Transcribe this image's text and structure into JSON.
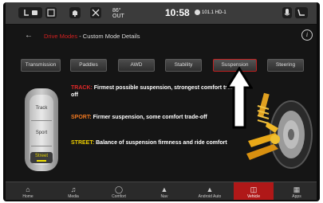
{
  "statusbar": {
    "outside_temp_label": "86°",
    "outside_temp_sub": "OUT",
    "time": "10:58",
    "radio_station": "101.1 HD-1"
  },
  "header": {
    "breadcrumb_parent": "Drive Modes",
    "breadcrumb_child": "Custom Mode Details",
    "back_icon": "back-arrow-icon",
    "info_glyph": "i"
  },
  "tabs": [
    {
      "label": "Transmission",
      "active": false
    },
    {
      "label": "Paddles",
      "active": false
    },
    {
      "label": "AWD",
      "active": false
    },
    {
      "label": "Stability",
      "active": false
    },
    {
      "label": "Suspension",
      "active": true
    },
    {
      "label": "Steering",
      "active": false
    }
  ],
  "mode_selector": {
    "options": [
      "Track",
      "Sport",
      "Street"
    ],
    "selected": "Street"
  },
  "descriptions": [
    {
      "key": "TRACK:",
      "key_color": "#e02828",
      "text": "Firmest possible suspension, strongest comfort trade-off"
    },
    {
      "key": "SPORT:",
      "key_color": "#f07820",
      "text": "Firmer suspension, some comfort trade-off"
    },
    {
      "key": "STREET:",
      "key_color": "#f0d000",
      "text": "Balance of suspension firmness and ride comfort"
    }
  ],
  "nav": [
    {
      "label": "Home",
      "icon": "home-icon",
      "active": false
    },
    {
      "label": "Media",
      "icon": "music-note-icon",
      "active": false
    },
    {
      "label": "Comfort",
      "icon": "comfort-icon",
      "active": false
    },
    {
      "label": "Nav",
      "icon": "navigation-arrow-icon",
      "active": false
    },
    {
      "label": "Android Auto",
      "icon": "android-auto-icon",
      "active": false
    },
    {
      "label": "Vehicle",
      "icon": "car-icon",
      "active": true
    },
    {
      "label": "Apps",
      "icon": "apps-grid-icon",
      "active": false
    }
  ],
  "colors": {
    "accent_red": "#b01818",
    "street_yellow": "#f0e000"
  }
}
